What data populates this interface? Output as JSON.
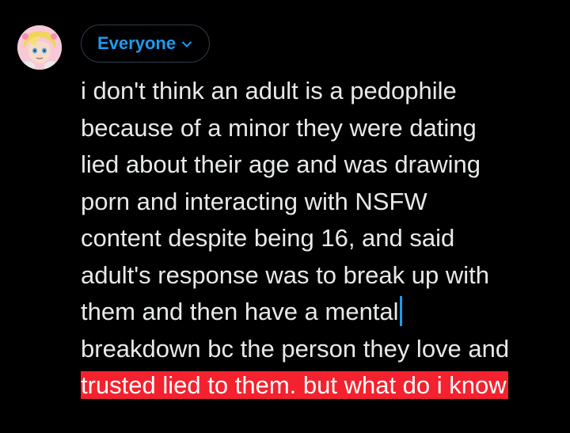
{
  "audience": {
    "label": "Everyone",
    "icon": "chevron-down-icon",
    "color": "#1d9bf0"
  },
  "avatar": {
    "icon": "avatar-icon"
  },
  "compose": {
    "lines": [
      "i don't think an adult is a pedophile",
      "because of a minor they were dating",
      "lied about their age and was drawing",
      "porn and interacting with NSFW",
      "content despite being 16, and said",
      "adult's response was to break up with",
      "them and then have a mental",
      "breakdown bc the person they love and",
      "trusted lied to them. but what do i know"
    ],
    "text_color": "#e7e9ea",
    "selection_color": "#f4212e",
    "caret_color": "#1d9bf0"
  }
}
